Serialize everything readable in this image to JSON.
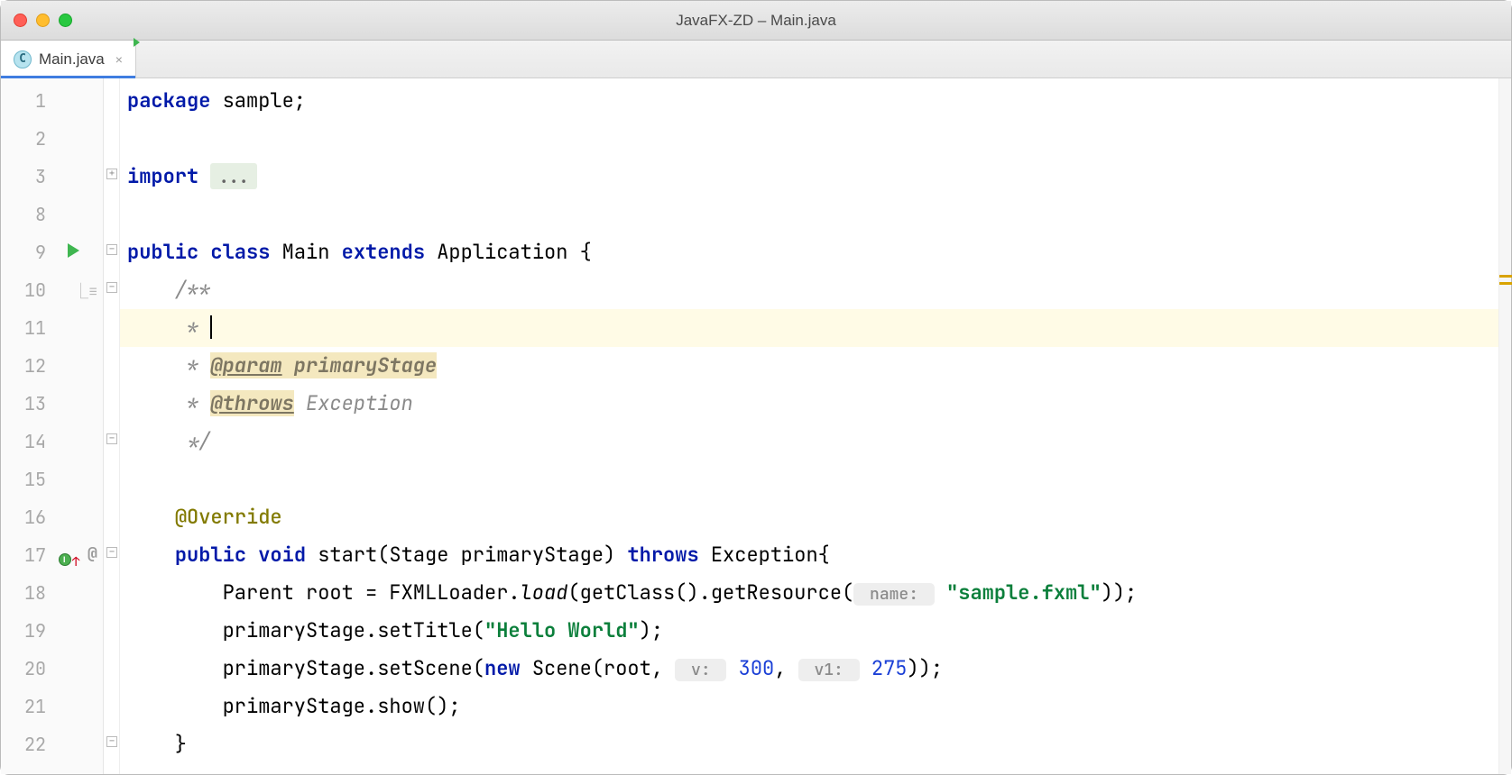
{
  "window": {
    "title": "JavaFX-ZD – Main.java"
  },
  "tab": {
    "label": "Main.java",
    "icon_letter": "C"
  },
  "gutter": {
    "line_numbers": [
      "1",
      "2",
      "3",
      "8",
      "9",
      "10",
      "11",
      "12",
      "13",
      "14",
      "15",
      "16",
      "17",
      "18",
      "19",
      "20",
      "21",
      "22"
    ]
  },
  "code": {
    "l1_kw": "package",
    "l1_rest": " sample;",
    "l3_kw": "import",
    "l3_fold": "...",
    "l9_public": "public",
    "l9_class": "class",
    "l9_main": " Main ",
    "l9_extends": "extends",
    "l9_app": " Application {",
    "l10": "    /**",
    "l11_prefix": "     * ",
    "l12_prefix": "     * ",
    "l12_tag": "@param",
    "l12_arg": " primaryStage",
    "l13_prefix": "     * ",
    "l13_tag": "@throws",
    "l13_arg": " Exception",
    "l14": "     */",
    "l16_ann": "@Override",
    "l17_public": "public",
    "l17_void": "void",
    "l17_sig1": " start(Stage primaryStage) ",
    "l17_throws": "throws",
    "l17_sig2": " Exception{",
    "l18_a": "        Parent root = FXMLLoader.",
    "l18_load": "load",
    "l18_b": "(getClass().getResource(",
    "l18_hint": " name: ",
    "l18_str": "\"sample.fxml\"",
    "l18_c": "));",
    "l19_a": "        primaryStage.setTitle(",
    "l19_str": "\"Hello World\"",
    "l19_b": ");",
    "l20_a": "        primaryStage.setScene(",
    "l20_new": "new",
    "l20_b": " Scene(root, ",
    "l20_h1": " v: ",
    "l20_n1": "300",
    "l20_c": ", ",
    "l20_h2": " v1: ",
    "l20_n2": "275",
    "l20_d": "));",
    "l21": "        primaryStage.show();",
    "l22": "    }"
  }
}
